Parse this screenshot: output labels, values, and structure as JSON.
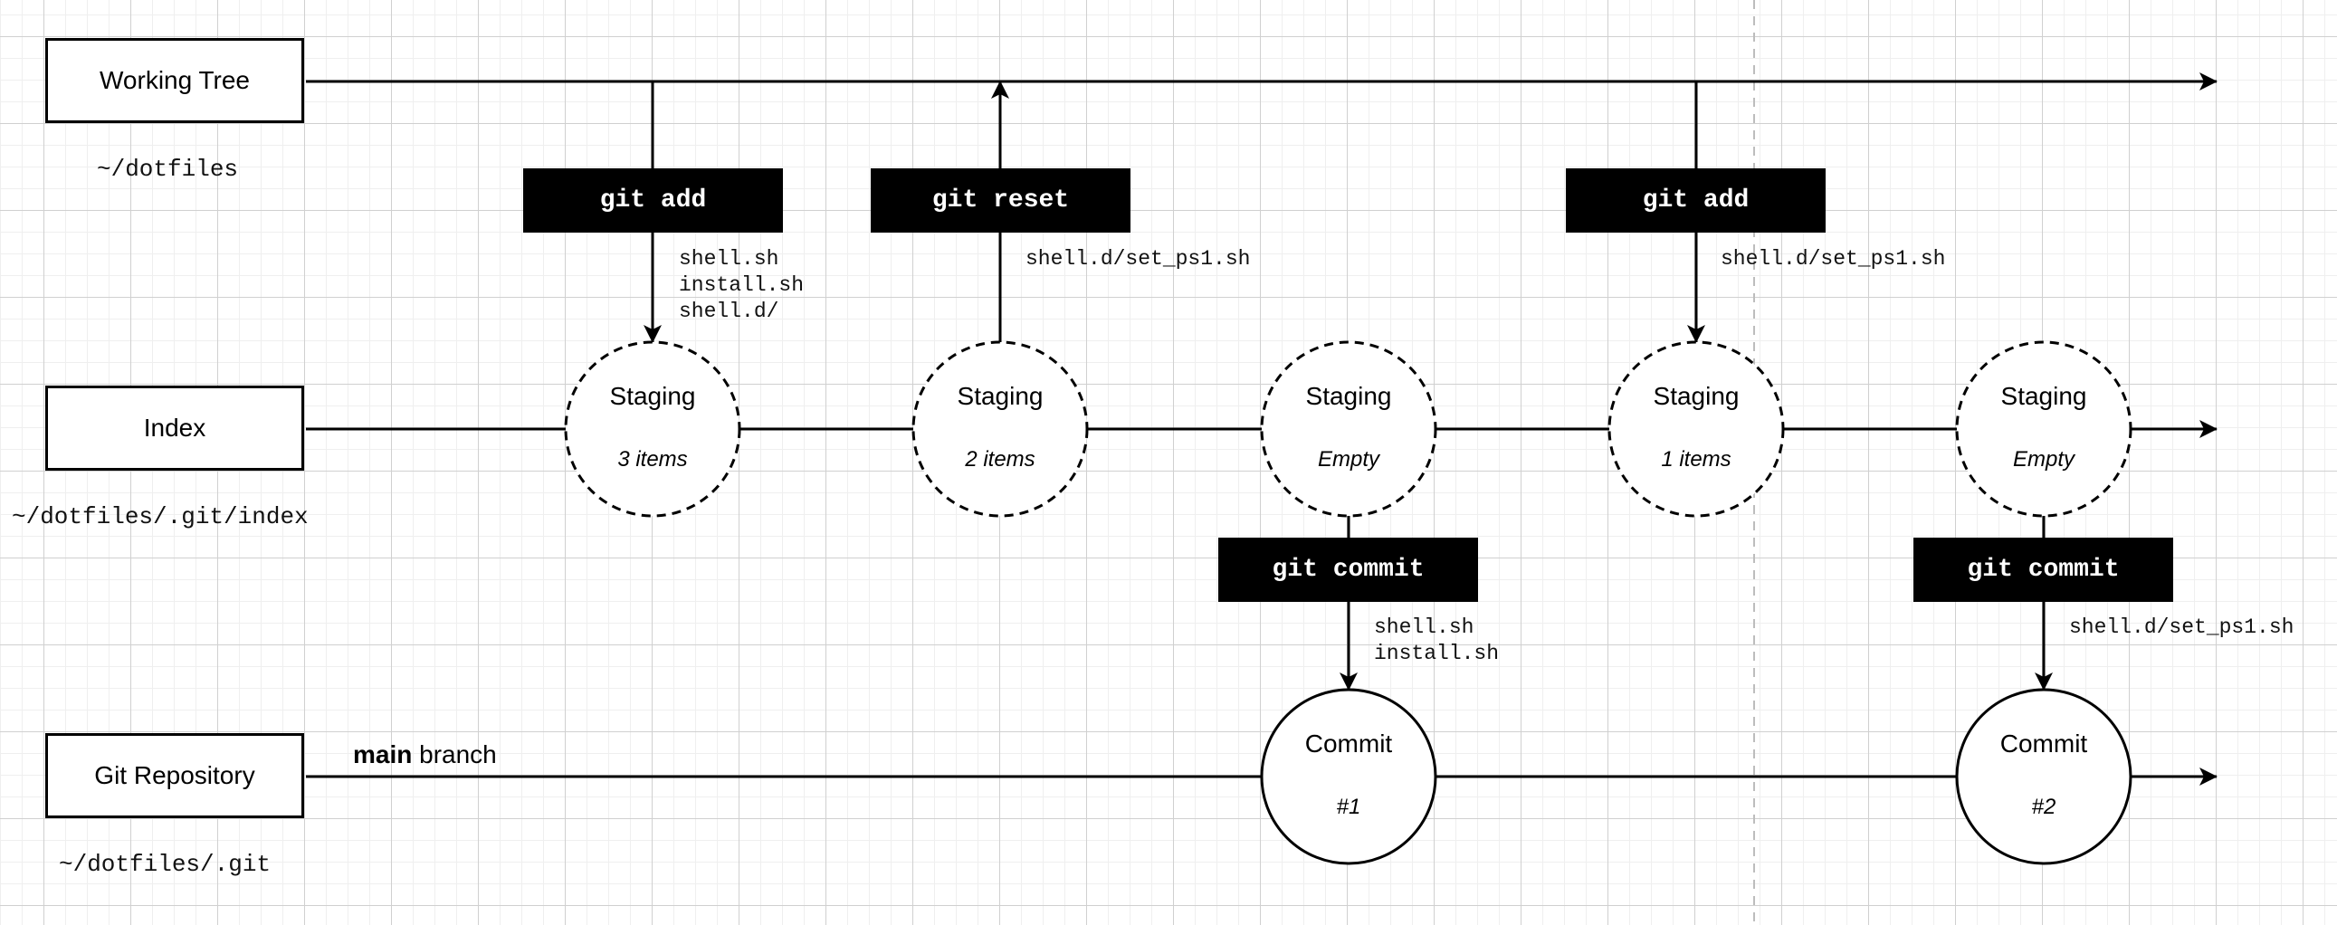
{
  "lanes": [
    {
      "title": "Working Tree",
      "path": "~/dotfiles"
    },
    {
      "title": "Index",
      "path": "~/dotfiles/.git/index"
    },
    {
      "title": "Git Repository",
      "path": "~/dotfiles/.git"
    }
  ],
  "branch": {
    "name": "main",
    "suffix": "branch"
  },
  "staging_nodes": [
    {
      "title": "Staging",
      "sub": "3 items"
    },
    {
      "title": "Staging",
      "sub": "2 items"
    },
    {
      "title": "Staging",
      "sub": "Empty"
    },
    {
      "title": "Staging",
      "sub": "1 items"
    },
    {
      "title": "Staging",
      "sub": "Empty"
    }
  ],
  "commit_nodes": [
    {
      "title": "Commit",
      "sub": "#1"
    },
    {
      "title": "Commit",
      "sub": "#2"
    }
  ],
  "commands": [
    {
      "label": "git add",
      "files": "shell.sh\ninstall.sh\nshell.d/"
    },
    {
      "label": "git reset",
      "files": "shell.d/set_ps1.sh"
    },
    {
      "label": "git add",
      "files": "shell.d/set_ps1.sh"
    },
    {
      "label": "git commit",
      "files": "shell.sh\ninstall.sh"
    },
    {
      "label": "git commit",
      "files": "shell.d/set_ps1.sh"
    }
  ]
}
